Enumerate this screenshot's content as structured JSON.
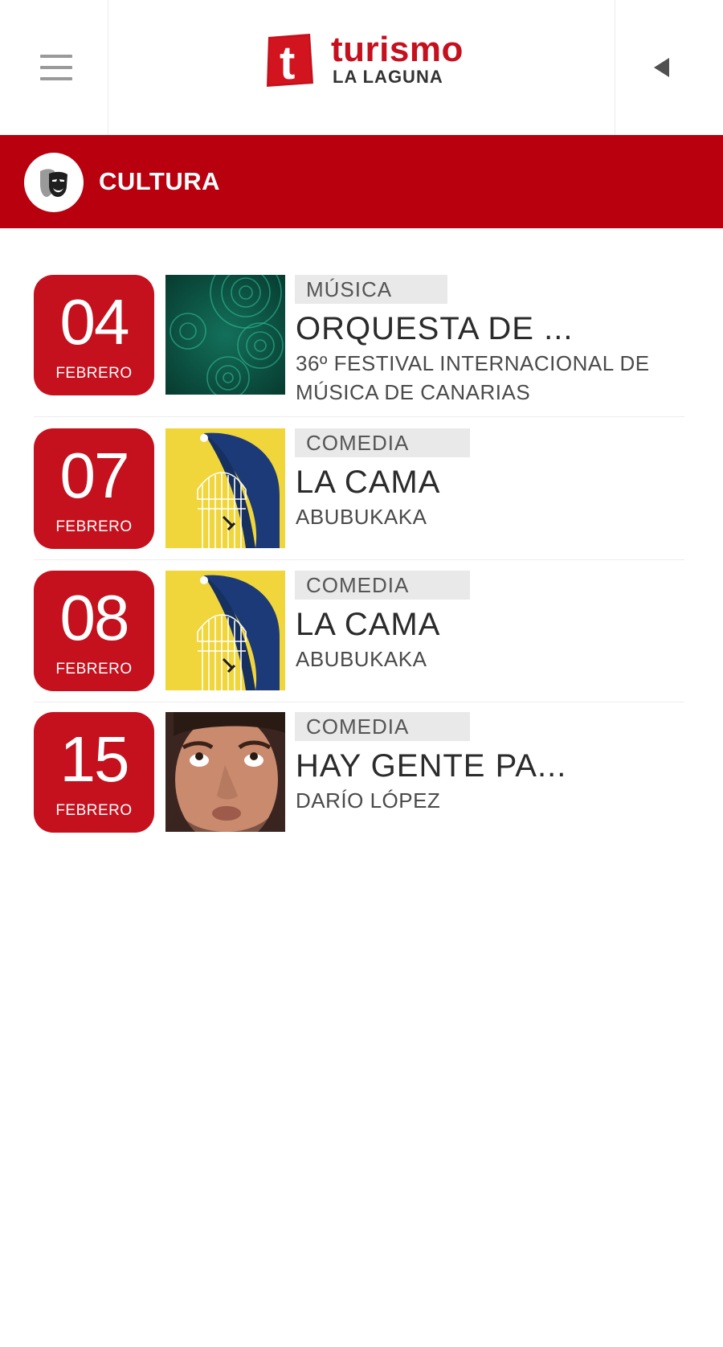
{
  "header": {
    "menu_icon": "hamburger-menu-icon",
    "back_icon": "back-arrow-icon",
    "logo": {
      "mark": "t",
      "word": "turismo",
      "sub": "LA LAGUNA",
      "color": "#c5101d"
    }
  },
  "section": {
    "title": "CULTURA",
    "icon": "theater-mask-icon",
    "color": "#b8000e"
  },
  "events": [
    {
      "day": "04",
      "month": "FEBRERO",
      "category": "MÚSICA",
      "title": "ORQUESTA DE ...",
      "subtitle": "36º FESTIVAL INTERNACIONAL DE MÚSICA DE CANARIAS",
      "image": "green-circles-poster"
    },
    {
      "day": "07",
      "month": "FEBRERO",
      "category": "COMEDIA",
      "title": "LA CAMA",
      "subtitle": "ABUBUKAKA",
      "image": "la-cama-poster"
    },
    {
      "day": "08",
      "month": "FEBRERO",
      "category": "COMEDIA",
      "title": "LA CAMA",
      "subtitle": "ABUBUKAKA",
      "image": "la-cama-poster"
    },
    {
      "day": "15",
      "month": "FEBRERO",
      "category": "COMEDIA",
      "title": "HAY GENTE PA...",
      "subtitle": "DARÍO LÓPEZ",
      "image": "comedian-face-photo"
    }
  ]
}
